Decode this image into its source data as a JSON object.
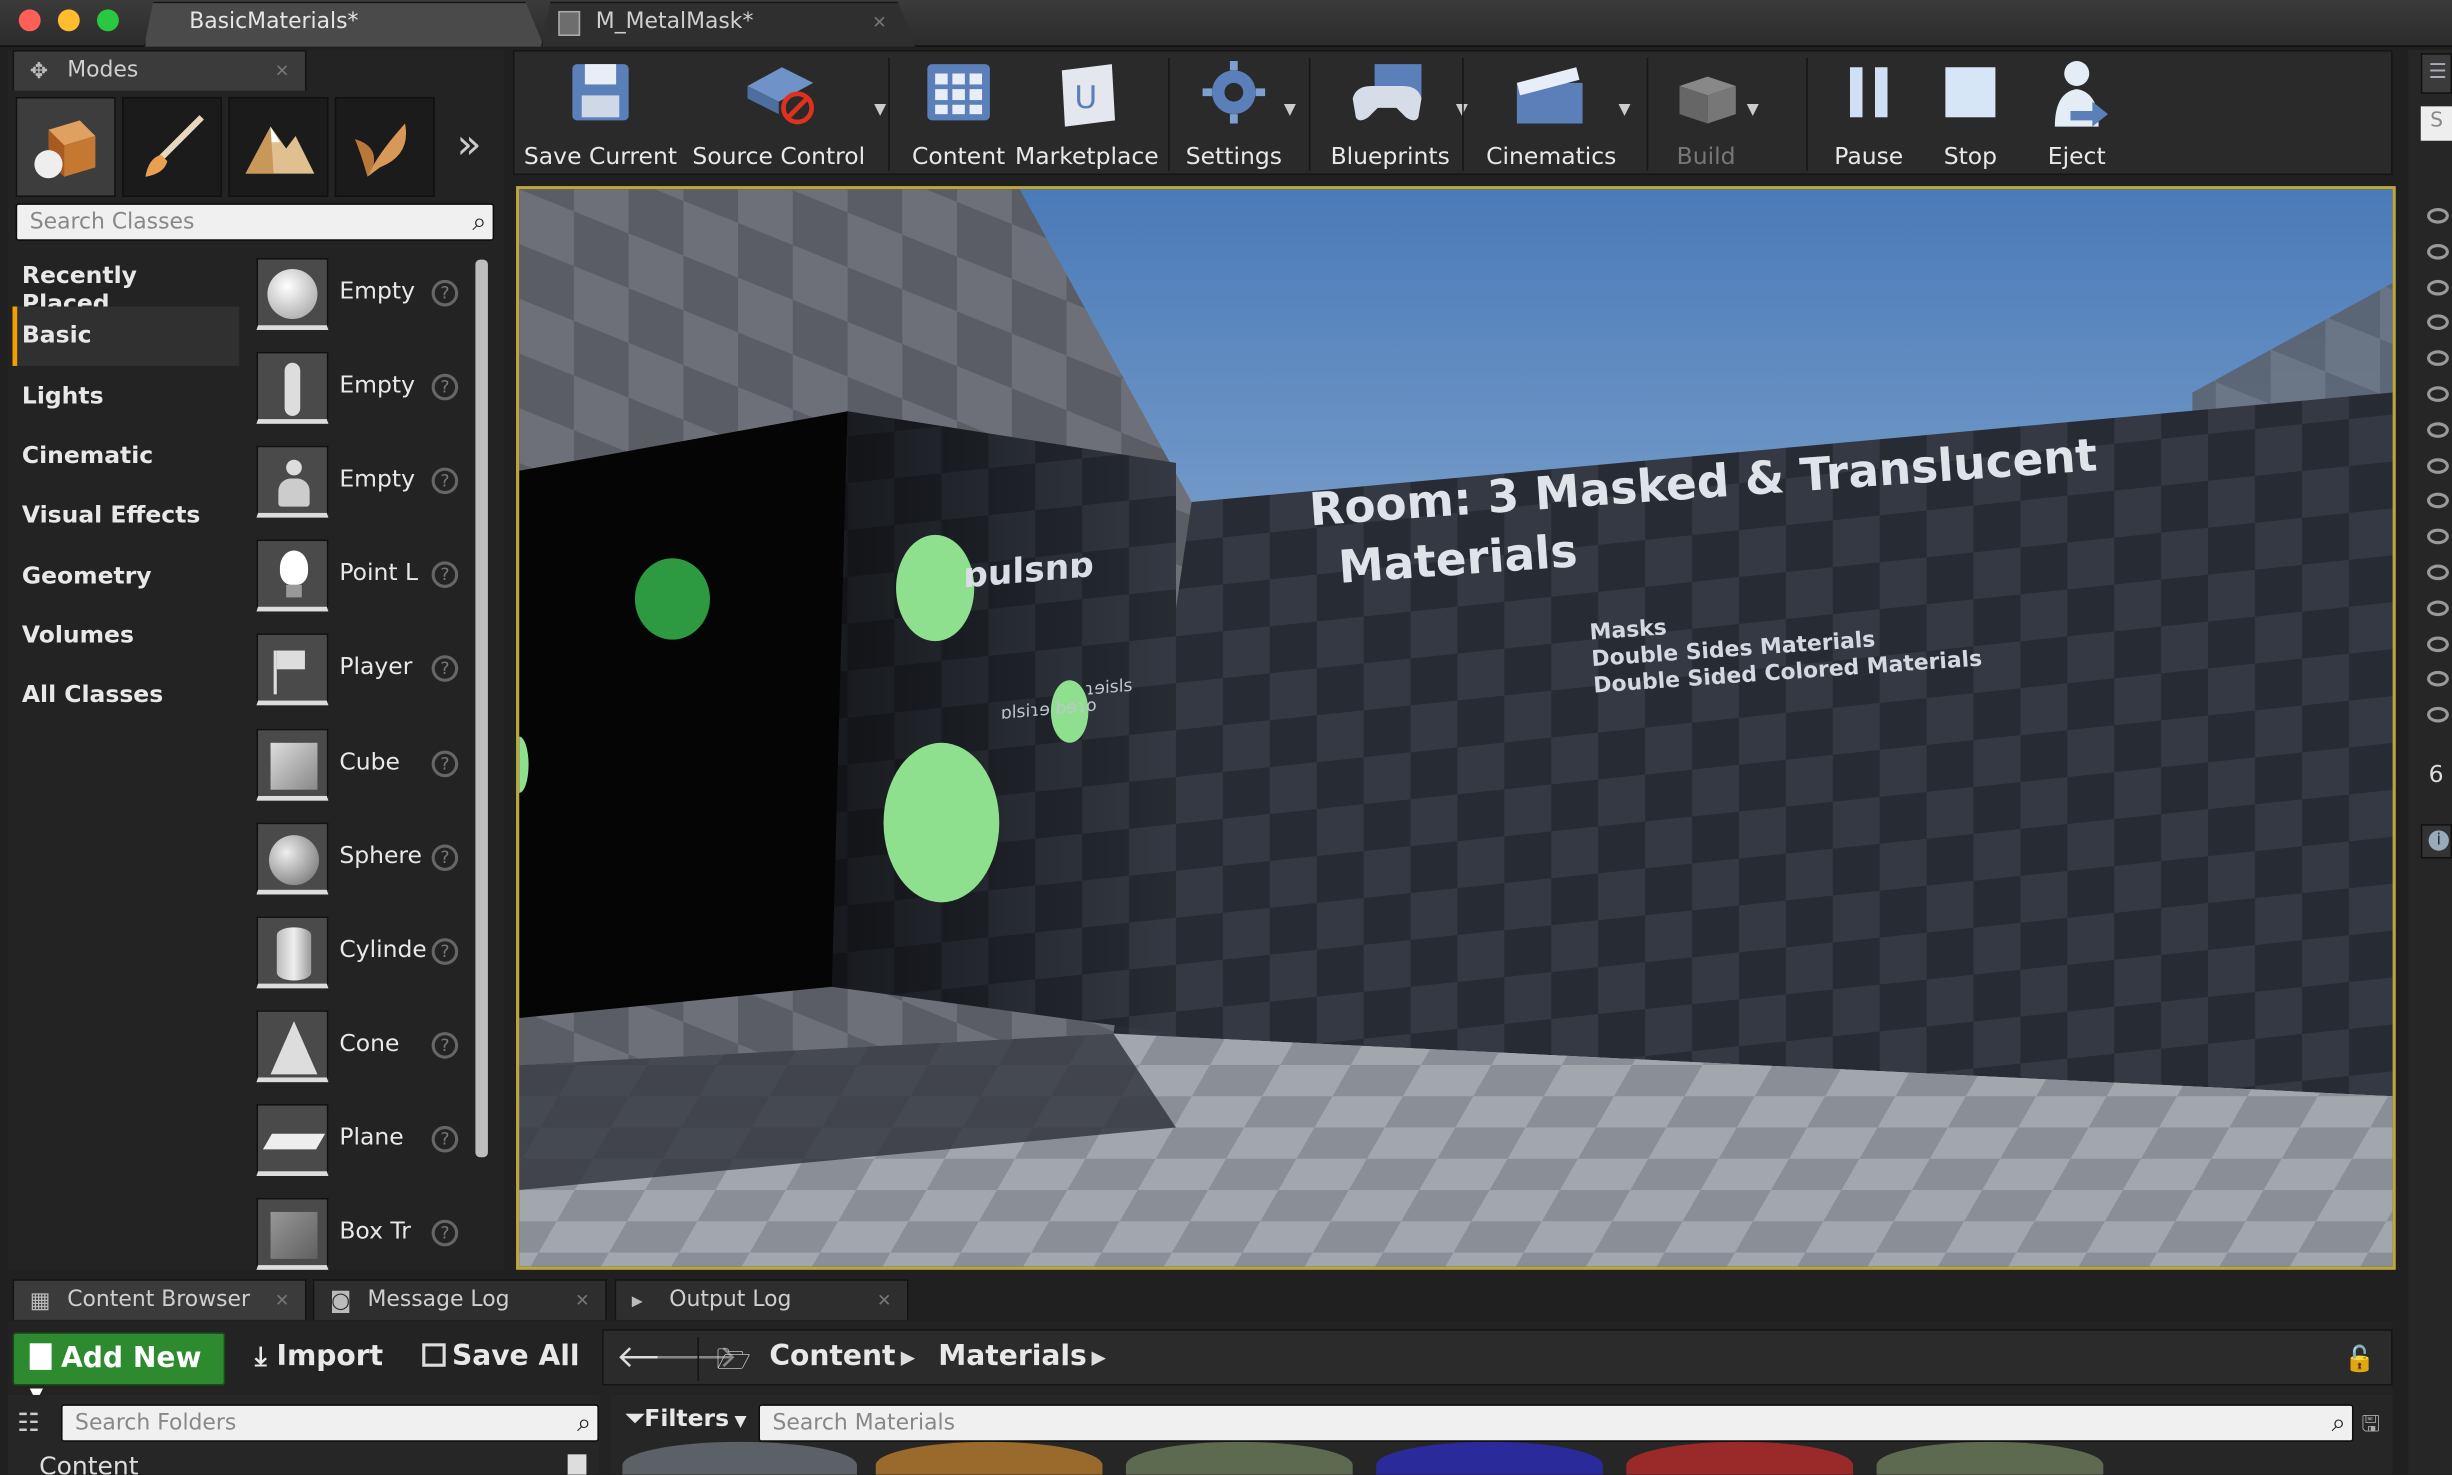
{
  "window": {
    "tabs": [
      {
        "label": "BasicMaterials*",
        "active": true
      },
      {
        "label": "M_MetalMask*",
        "active": false
      }
    ],
    "traffic_colors": [
      "#ff5f57",
      "#febc2e",
      "#28c840"
    ]
  },
  "modes_panel": {
    "tab_label": "Modes",
    "search_placeholder": "Search Classes",
    "more_glyph": "»",
    "categories": [
      {
        "label": "Recently Placed",
        "selected": false
      },
      {
        "label": "Basic",
        "selected": true
      },
      {
        "label": "Lights",
        "selected": false
      },
      {
        "label": "Cinematic",
        "selected": false
      },
      {
        "label": "Visual Effects",
        "selected": false
      },
      {
        "label": "Geometry",
        "selected": false
      },
      {
        "label": "Volumes",
        "selected": false
      },
      {
        "label": "All Classes",
        "selected": false
      }
    ],
    "items": [
      {
        "label": "Empty",
        "icon": "empty-actor-icon"
      },
      {
        "label": "Empty",
        "icon": "empty-character-icon"
      },
      {
        "label": "Empty",
        "icon": "empty-pawn-icon"
      },
      {
        "label": "Point L",
        "icon": "point-light-icon"
      },
      {
        "label": "Player",
        "icon": "player-start-icon"
      },
      {
        "label": "Cube",
        "icon": "cube-icon"
      },
      {
        "label": "Sphere",
        "icon": "sphere-icon"
      },
      {
        "label": "Cylinde",
        "icon": "cylinder-icon"
      },
      {
        "label": "Cone",
        "icon": "cone-icon"
      },
      {
        "label": "Plane",
        "icon": "plane-icon"
      },
      {
        "label": "Box Tr",
        "icon": "box-trigger-icon"
      }
    ],
    "help_glyph": "?"
  },
  "toolbar": {
    "buttons": [
      {
        "label": "Save Current",
        "icon": "save-icon",
        "dropdown": false,
        "enabled": true
      },
      {
        "label": "Source Control",
        "icon": "source-control-icon",
        "dropdown": true,
        "enabled": true
      },
      {
        "label": "Content",
        "icon": "content-icon",
        "dropdown": false,
        "enabled": true
      },
      {
        "label": "Marketplace",
        "icon": "marketplace-icon",
        "dropdown": false,
        "enabled": true
      },
      {
        "label": "Settings",
        "icon": "settings-icon",
        "dropdown": true,
        "enabled": true
      },
      {
        "label": "Blueprints",
        "icon": "blueprints-icon",
        "dropdown": true,
        "enabled": true
      },
      {
        "label": "Cinematics",
        "icon": "cinematics-icon",
        "dropdown": true,
        "enabled": true
      },
      {
        "label": "Build",
        "icon": "build-icon",
        "dropdown": true,
        "enabled": false
      },
      {
        "label": "Pause",
        "icon": "pause-icon",
        "dropdown": false,
        "enabled": true
      },
      {
        "label": "Stop",
        "icon": "stop-icon",
        "dropdown": false,
        "enabled": true
      },
      {
        "label": "Eject",
        "icon": "eject-icon",
        "dropdown": false,
        "enabled": true
      }
    ]
  },
  "viewport": {
    "room_title_line1": "Room: 3 Masked & Translucent",
    "room_title_line2": "Materials",
    "room_items": [
      "Masks",
      "Double Sides Materials",
      "Double Sided Colored Materials"
    ],
    "mirrored_text_1": "ɒulsnɒ",
    "mirrored_text_2": "ɿɘisls",
    "mirrored_text_3": "ɒlsiɿɘ bɘɿo",
    "accent_color": "#bda63d"
  },
  "bottom_tabs": [
    {
      "label": "Content Browser",
      "icon": "content-browser-icon",
      "active": true
    },
    {
      "label": "Message Log",
      "icon": "message-log-icon",
      "active": false
    },
    {
      "label": "Output Log",
      "icon": "output-log-icon",
      "active": false
    }
  ],
  "content_browser": {
    "add_new_label": "Add New",
    "import_label": "Import",
    "save_all_label": "Save All",
    "path": [
      "Content",
      "Materials"
    ],
    "search_folders_placeholder": "Search Folders",
    "filters_label": "Filters",
    "search_materials_placeholder": "Search Materials",
    "folder_root": "Content",
    "accent_green": "#2e8a2e"
  },
  "right_strip": {
    "partial_text_top": "S",
    "partial_text_bottom": "6"
  }
}
